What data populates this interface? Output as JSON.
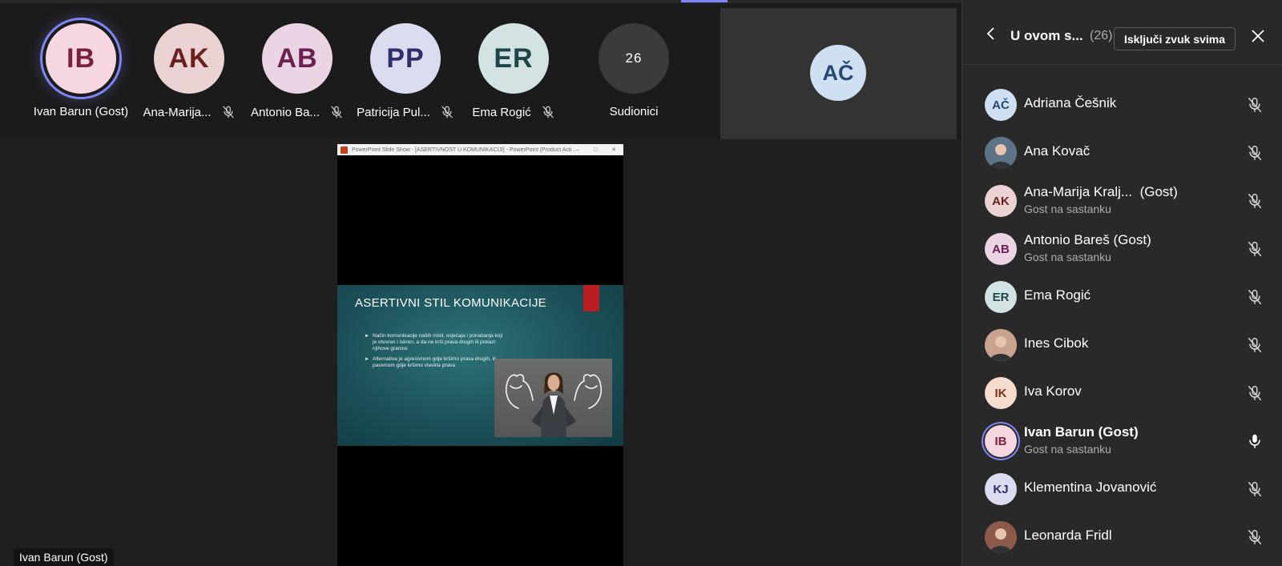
{
  "colors": {
    "accent": "#7f85f5",
    "panel_bg": "#292929",
    "stage_bg": "#1f1f1f"
  },
  "gallery": {
    "tiles": [
      {
        "initials": "IB",
        "name": "Ivan Barun (Gost)",
        "muted": false,
        "speaking": true,
        "bg": "#f6d6e0",
        "fg": "#7a1f3d"
      },
      {
        "initials": "AK",
        "name": "Ana-Marija...",
        "muted": true,
        "bg": "#ecd3d3",
        "fg": "#6b2020"
      },
      {
        "initials": "AB",
        "name": "Antonio Ba...",
        "muted": true,
        "bg": "#ebd4e3",
        "fg": "#6b2050"
      },
      {
        "initials": "PP",
        "name": "Patricija Pul...",
        "muted": true,
        "bg": "#dcdcf0",
        "fg": "#2e2e6b"
      },
      {
        "initials": "ER",
        "name": "Ema Rogić",
        "muted": true,
        "bg": "#d3e2e3",
        "fg": "#1e4547"
      }
    ],
    "overflow": {
      "count": "26",
      "label": "Sudionici"
    },
    "large_tile": {
      "initials": "AČ"
    }
  },
  "share": {
    "window_title": "PowerPoint Slide Show - [ASERTIVNOST U KOMUNIKACIJI] - PowerPoint (Product Acti...",
    "window_buttons": "–  □  ✕",
    "slide": {
      "title": "ASERTIVNI STIL KOMUNIKACIJE",
      "bullets": [
        "Način komunikacije naših misli, osjećaja i ponašanja koji je otvoren i iskren, a da ne krši prava drugih ili prelazi njihove granice",
        "Alternativa je agresivnom gdje kršimo prava drugih, ili pasivnom gdje kršimo vlastita prava"
      ]
    },
    "presenter_label": "Ivan Barun (Gost)"
  },
  "panel": {
    "title": "U ovom s...",
    "count": "(26)",
    "mute_all_label": "Isključi zvuk svima",
    "participants": [
      {
        "initials": "AČ",
        "name": "Adriana Češnik",
        "muted": true,
        "bg": "#cfe0f3",
        "fg": "#274674"
      },
      {
        "initials": "",
        "name": "Ana Kovač",
        "muted": true,
        "photo": true,
        "bg": "#5d7488"
      },
      {
        "initials": "AK",
        "name": "Ana-Marija Kralj...",
        "guest": "(Gost)",
        "sub": "Gost na sastanku",
        "muted": true,
        "bg": "#ecd3d3",
        "fg": "#6b2020"
      },
      {
        "initials": "AB",
        "name": "Antonio Bareš (Gost)",
        "sub": "Gost na sastanku",
        "muted": true,
        "bg": "#ebd4e3",
        "fg": "#6b2050"
      },
      {
        "initials": "ER",
        "name": "Ema Rogić",
        "muted": true,
        "bg": "#d3e2e3",
        "fg": "#1e4547"
      },
      {
        "initials": "",
        "name": "Ines Cibok",
        "muted": true,
        "photo": true,
        "bg": "#c9a38f"
      },
      {
        "initials": "IK",
        "name": "Iva Korov",
        "muted": true,
        "bg": "#f6dccf",
        "fg": "#7a3416"
      },
      {
        "initials": "IB",
        "name": "Ivan Barun (Gost)",
        "sub": "Gost na sastanku",
        "muted": false,
        "speaking": true,
        "bold": true,
        "bg": "#f6d6e0",
        "fg": "#7a1f3d"
      },
      {
        "initials": "KJ",
        "name": "Klementina Jovanović",
        "muted": true,
        "bg": "#dcdcf0",
        "fg": "#2e2e6b"
      },
      {
        "initials": "",
        "name": "Leonarda Fridl",
        "muted": true,
        "photo": true,
        "bg": "#8b5a4a"
      }
    ]
  }
}
